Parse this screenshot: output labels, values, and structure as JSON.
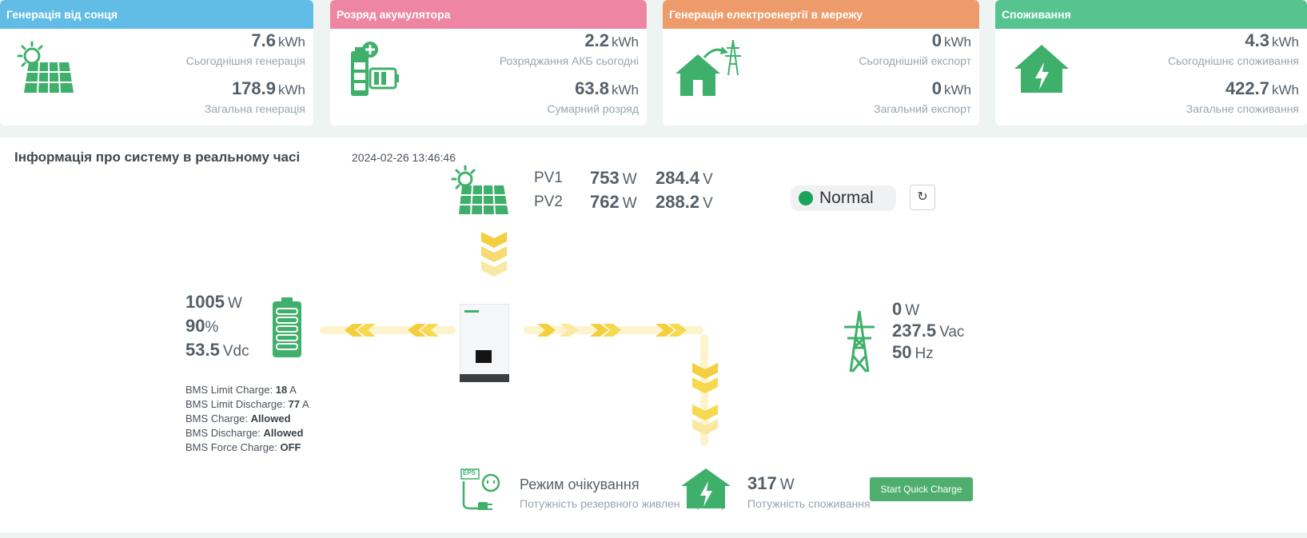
{
  "colors": {
    "solar": "#62bde6",
    "battery": "#ee86a3",
    "grid": "#ee9b6b",
    "consumption": "#55c48e",
    "icon_green": "#3fb06b",
    "flow_yellow": "#f3d24a"
  },
  "cards": [
    {
      "title": "Генерація від сонця",
      "icon": "solar-panel-icon",
      "today_value": "7.6",
      "today_unit": "kWh",
      "today_label": "Сьогоднішня генерація",
      "total_value": "178.9",
      "total_unit": "kWh",
      "total_label": "Загальна генерація"
    },
    {
      "title": "Розряд акумулятора",
      "icon": "battery-icon",
      "today_value": "2.2",
      "today_unit": "kWh",
      "today_label": "Розряджання АКБ сьогодні",
      "total_value": "63.8",
      "total_unit": "kWh",
      "total_label": "Сумарний розряд"
    },
    {
      "title": "Генерація електроенергії в мережу",
      "icon": "grid-export-icon",
      "today_value": "0",
      "today_unit": "kWh",
      "today_label": "Сьогоднішній експорт",
      "total_value": "0",
      "total_unit": "kWh",
      "total_label": "Загальний експорт"
    },
    {
      "title": "Споживання",
      "icon": "home-consumption-icon",
      "today_value": "4.3",
      "today_unit": "kWh",
      "today_label": "Сьогоднішнє споживання",
      "total_value": "422.7",
      "total_unit": "kWh",
      "total_label": "Загальне споживання"
    }
  ],
  "realtime": {
    "title": "Інформація про систему в реальному часі",
    "timestamp": "2024-02-26 13:46:46",
    "pv": [
      {
        "label": "PV1",
        "power": "753",
        "power_unit": "W",
        "voltage": "284.4",
        "voltage_unit": "V"
      },
      {
        "label": "PV2",
        "power": "762",
        "power_unit": "W",
        "voltage": "288.2",
        "voltage_unit": "V"
      }
    ],
    "status": "Normal",
    "refresh_icon": "refresh-icon",
    "battery": {
      "power": "1005",
      "power_unit": "W",
      "soc": "90",
      "soc_unit": "%",
      "voltage": "53.5",
      "voltage_unit": "Vdc",
      "bms": [
        {
          "label": "BMS Limit Charge:",
          "value": "18",
          "unit": "A"
        },
        {
          "label": "BMS Limit Discharge:",
          "value": "77",
          "unit": "A"
        },
        {
          "label": "BMS Charge:",
          "value": "Allowed",
          "unit": ""
        },
        {
          "label": "BMS Discharge:",
          "value": "Allowed",
          "unit": ""
        },
        {
          "label": "BMS Force Charge:",
          "value": "OFF",
          "unit": ""
        }
      ]
    },
    "grid": {
      "power": "0",
      "power_unit": "W",
      "voltage": "237.5",
      "voltage_unit": "Vac",
      "frequency": "50",
      "frequency_unit": "Hz"
    },
    "eps": {
      "badge": "EPS",
      "mode": "Режим очікування",
      "label": "Потужність резервного живлення (EPS)"
    },
    "load": {
      "power": "317",
      "power_unit": "W",
      "label": "Потужність споживання"
    },
    "quick_charge_label": "Start Quick Charge"
  }
}
